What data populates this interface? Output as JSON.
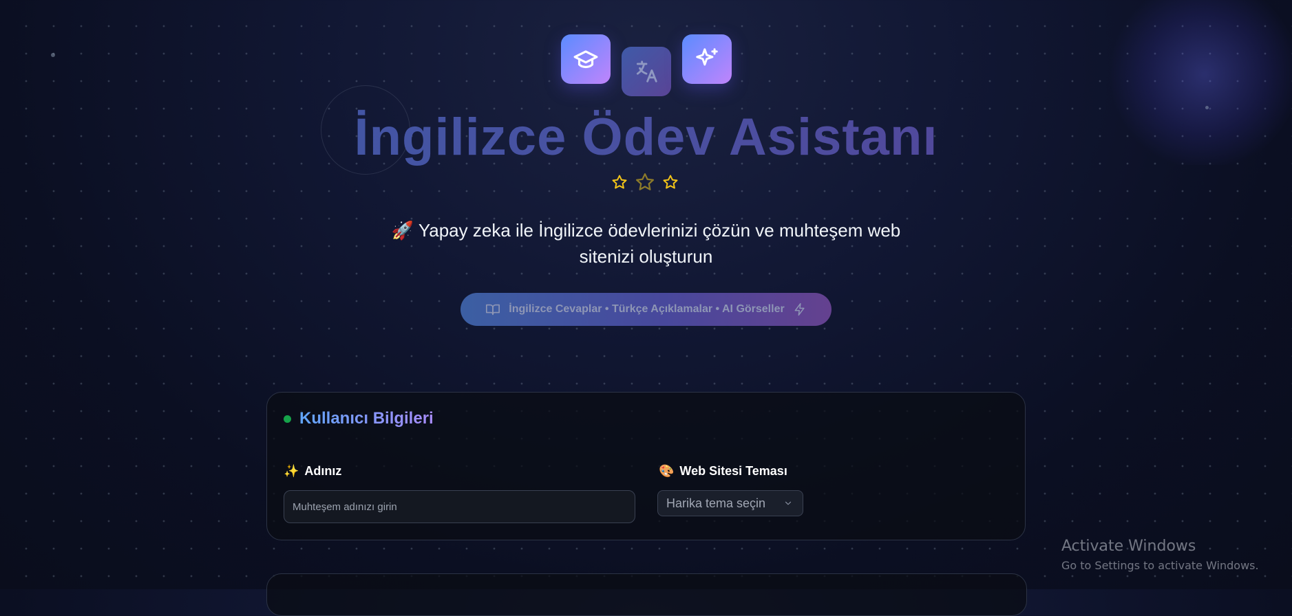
{
  "header": {
    "icons": [
      "graduation-cap-icon",
      "translate-icon",
      "sparkles-icon"
    ],
    "title": "İngilizce Ödev Asistanı",
    "rating_stars": 3,
    "subtitle_emoji": "🚀",
    "subtitle": "Yapay zeka ile İngilizce ödevlerinizi çözün ve muhteşem web sitenizi oluşturun",
    "pill": {
      "text": "İngilizce Cevaplar • Türkçe Açıklamalar • AI Görseller",
      "left_icon": "book-open-icon",
      "right_icon": "lightning-icon"
    }
  },
  "user_info": {
    "title": "Kullanıcı Bilgileri",
    "name_field": {
      "emoji": "✨",
      "label": "Adınız",
      "placeholder": "Muhteşem adınızı girin",
      "value": ""
    },
    "theme_field": {
      "emoji": "🎨",
      "label": "Web Sitesi Teması",
      "selected": "Harika tema seçin"
    }
  },
  "watermark": {
    "title": "Activate Windows",
    "subtitle": "Go to Settings to activate Windows."
  },
  "colors": {
    "background": "#0f1428",
    "accent_blue": "#60a5fa",
    "accent_purple": "#a78bfa",
    "star": "#f5c518",
    "status_green": "#16a34a"
  }
}
